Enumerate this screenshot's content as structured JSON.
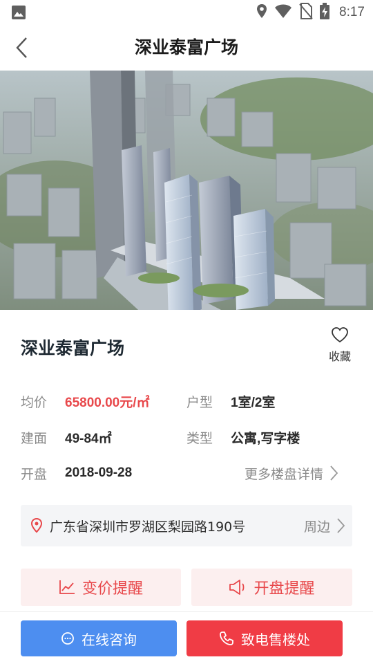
{
  "status_bar": {
    "time": "8:17",
    "icons": [
      "image-icon",
      "location-icon",
      "wifi-icon",
      "no-sim-icon",
      "battery-charging-icon"
    ]
  },
  "header": {
    "title": "深业泰富广场",
    "back_icon": "chevron-left-icon"
  },
  "hero": {
    "description_icon": "building-photo"
  },
  "project": {
    "name": "深业泰富广场",
    "favorite_label": "收藏",
    "price_label": "均价",
    "price_value": "65800.00元/㎡",
    "layout_label": "户型",
    "layout_value": "1室/2室",
    "area_label": "建面",
    "area_value": "49-84㎡",
    "type_label": "类型",
    "type_value": "公寓,写字楼",
    "open_label": "开盘",
    "open_value": "2018-09-28",
    "more_details": "更多楼盘详情"
  },
  "address": {
    "text": "广东省深圳市罗湖区梨园路190号",
    "nearby": "周边"
  },
  "alerts": {
    "price_alert": "变价提醒",
    "open_alert": "开盘提醒"
  },
  "bottom": {
    "consult": "在线咨询",
    "call": "致电售楼处"
  },
  "colors": {
    "accent_red": "#e8484b",
    "button_blue": "#4d8ef0",
    "button_red": "#f03c45",
    "alert_bg": "#fcefef"
  }
}
